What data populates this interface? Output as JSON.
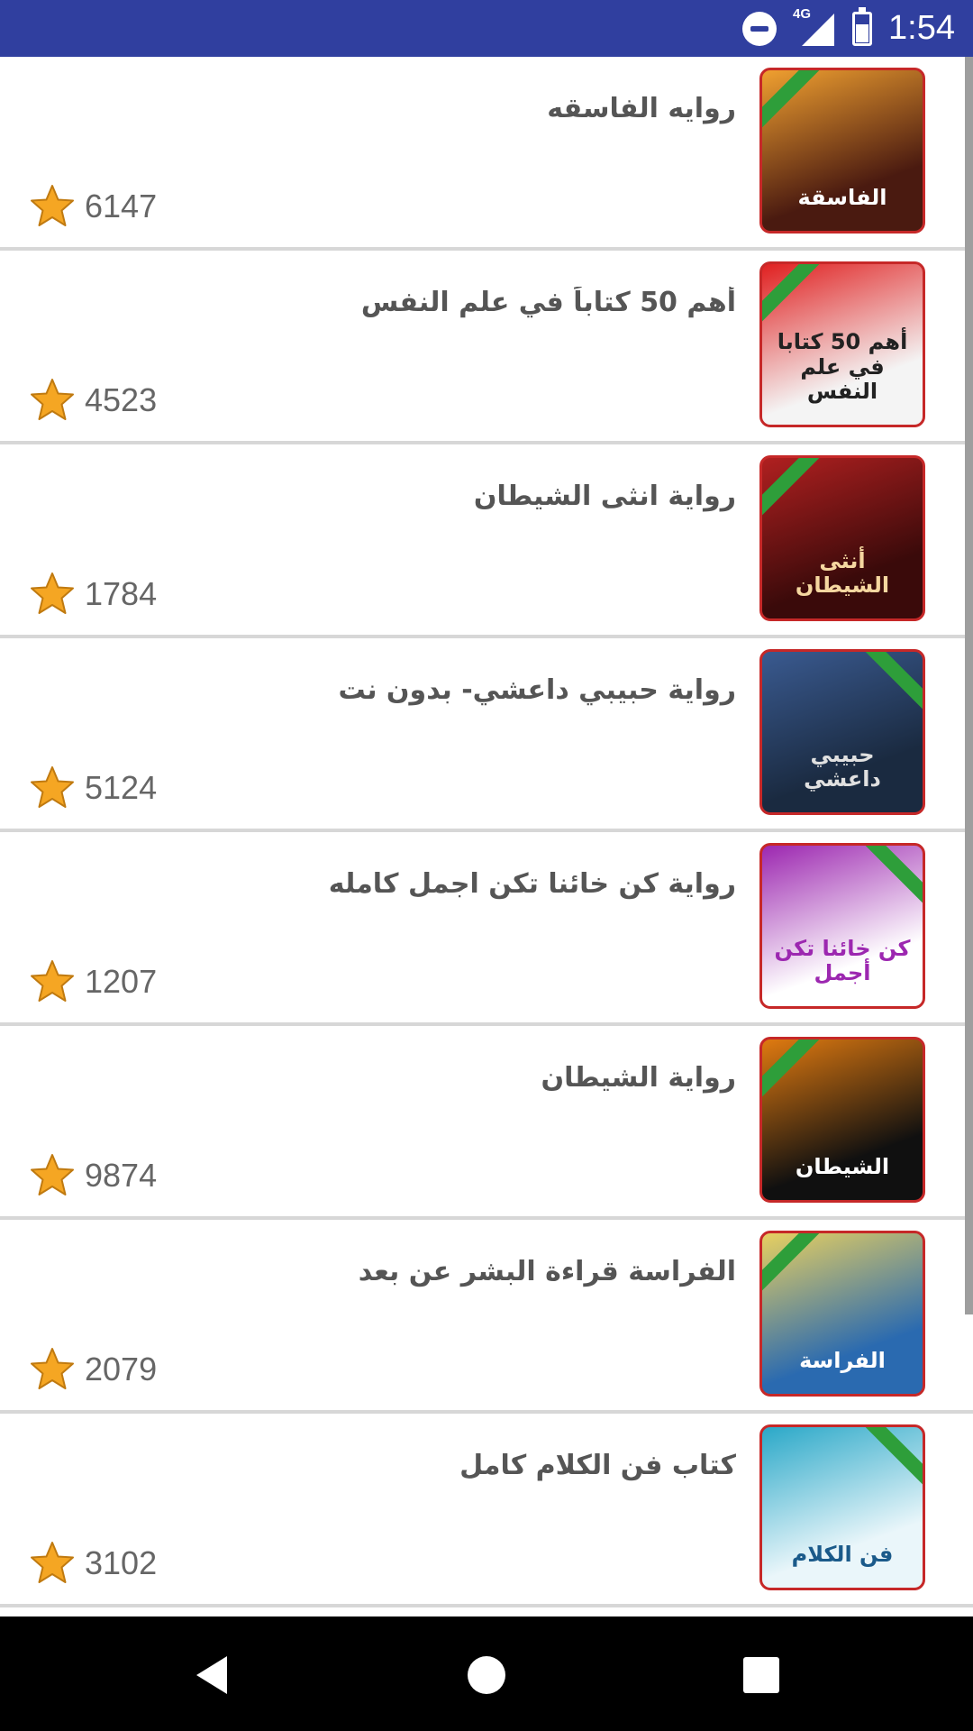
{
  "status_bar": {
    "time": "1:54",
    "network_type": "4G",
    "icons": [
      "do-not-disturb-icon",
      "signal-icon",
      "battery-charging-icon"
    ]
  },
  "books": [
    {
      "title": "روايه الفاسقه",
      "count": "6147",
      "cover_bg": "#4a1a10",
      "cover_accent": "#f0a030",
      "cover_text": "الفاسقة",
      "cover_text_color": "#ffffff"
    },
    {
      "title": "أهم 50 كتاباً في علم النفس",
      "count": "4523",
      "cover_bg": "#f4f4f4",
      "cover_accent": "#e02020",
      "cover_text": "أهم 50 كتابا في علم النفس",
      "cover_text_color": "#222222"
    },
    {
      "title": "رواية انثى الشيطان",
      "count": "1784",
      "cover_bg": "#3a0a0a",
      "cover_accent": "#b02020",
      "cover_text": "أنثى الشيطان",
      "cover_text_color": "#f5d7a0"
    },
    {
      "title": "رواية حبيبي داعشي- بدون نت",
      "count": "5124",
      "cover_bg": "#1a2a40",
      "cover_accent": "#3a5a90",
      "cover_text": "حبيبي داعشي",
      "cover_text_color": "#e0e0e0"
    },
    {
      "title": "رواية كن خائنا تكن اجمل كامله",
      "count": "1207",
      "cover_bg": "#ffffff",
      "cover_accent": "#9c27b0",
      "cover_text": "كن خائنا تكن أجمل",
      "cover_text_color": "#9c27b0"
    },
    {
      "title": "رواية الشيطان",
      "count": "9874",
      "cover_bg": "#101010",
      "cover_accent": "#e07a10",
      "cover_text": "الشيطان",
      "cover_text_color": "#ffffff"
    },
    {
      "title": "الفراسة قراءة البشر عن بعد",
      "count": "2079",
      "cover_bg": "#2a6ab0",
      "cover_accent": "#e8d060",
      "cover_text": "الفراسة",
      "cover_text_color": "#ffffff"
    },
    {
      "title": "كتاب فن الكلام كامل",
      "count": "3102",
      "cover_bg": "#eaf6fa",
      "cover_accent": "#2aa8c8",
      "cover_text": "فن الكلام",
      "cover_text_color": "#1a5a8a"
    }
  ],
  "colors": {
    "status_bar": "#303f9f",
    "divider": "#d7d7d7",
    "star": "#f5a623",
    "title_text": "#555555",
    "count_text": "#666666"
  },
  "nav_bar": {
    "icons": [
      "back-icon",
      "home-icon",
      "recents-icon"
    ]
  }
}
